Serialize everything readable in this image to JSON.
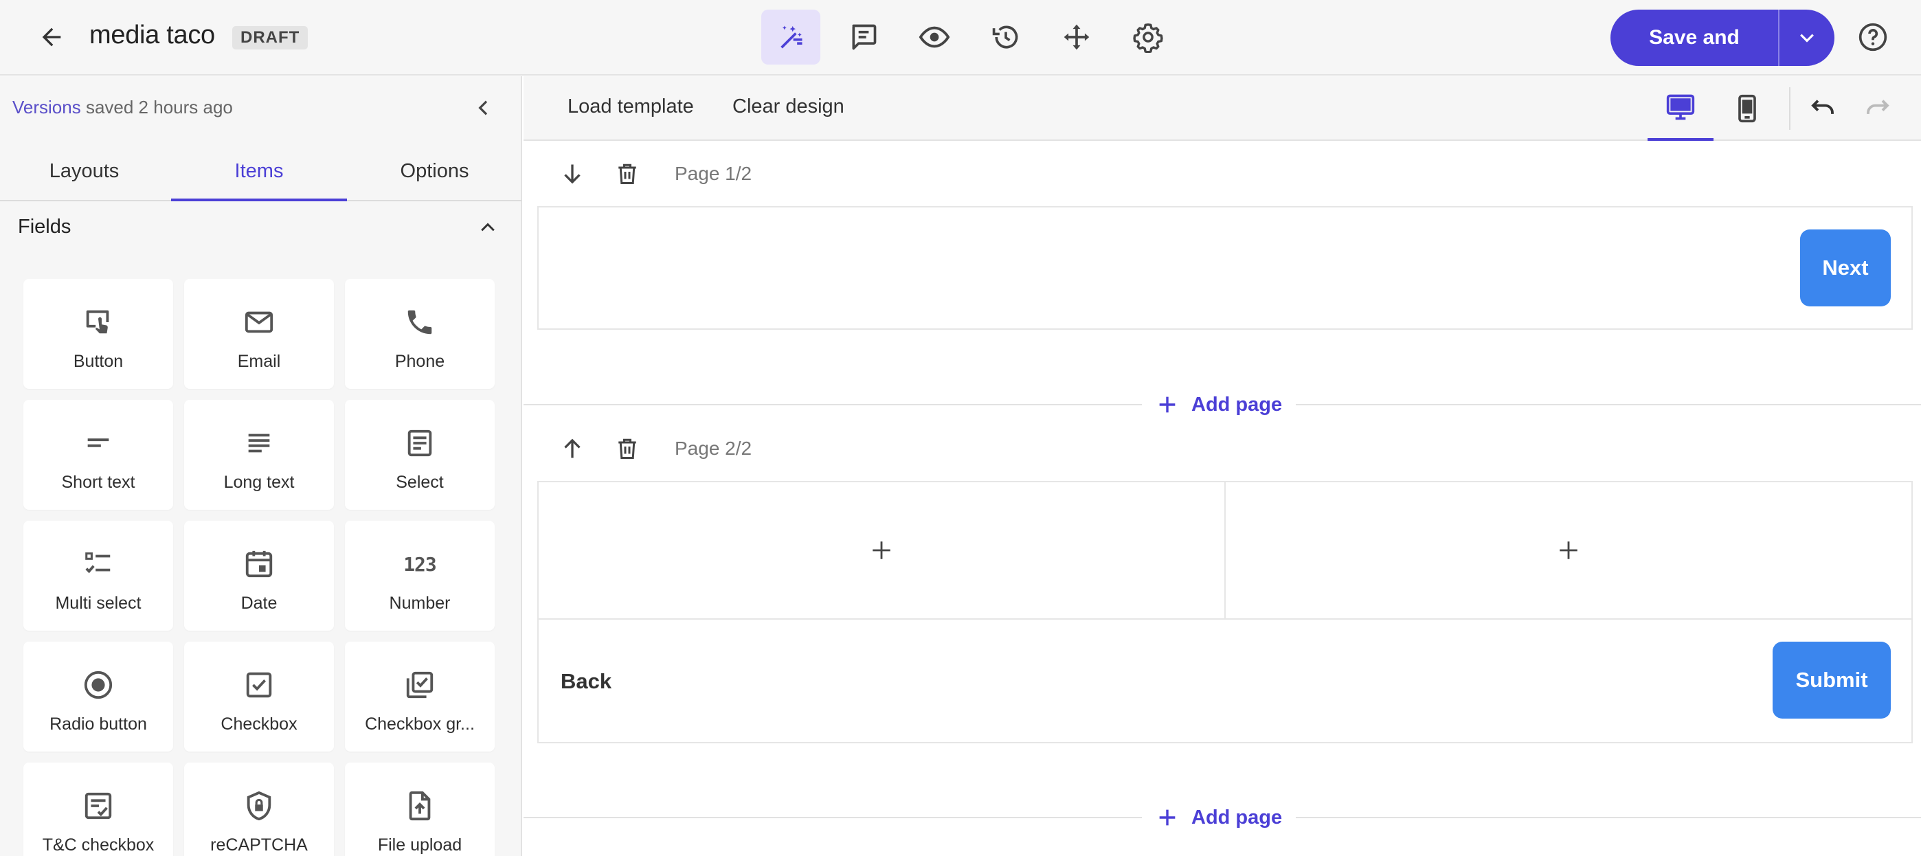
{
  "header": {
    "title": "media taco",
    "badge": "DRAFT",
    "save_label": "Save and exit"
  },
  "sidebar": {
    "versions_link": "Versions",
    "versions_text": " saved 2 hours ago",
    "tabs": [
      {
        "label": "Layouts"
      },
      {
        "label": "Items"
      },
      {
        "label": "Options"
      }
    ],
    "section_title": "Fields",
    "fields": [
      {
        "label": "Button",
        "icon": "touch-icon"
      },
      {
        "label": "Email",
        "icon": "envelope-icon"
      },
      {
        "label": "Phone",
        "icon": "phone-icon"
      },
      {
        "label": "Short text",
        "icon": "short-text-icon"
      },
      {
        "label": "Long text",
        "icon": "long-text-icon"
      },
      {
        "label": "Select",
        "icon": "select-icon"
      },
      {
        "label": "Multi select",
        "icon": "checklist-icon"
      },
      {
        "label": "Date",
        "icon": "calendar-icon"
      },
      {
        "label": "Number",
        "icon": "number-icon"
      },
      {
        "label": "Radio button",
        "icon": "radio-icon"
      },
      {
        "label": "Checkbox",
        "icon": "checkbox-icon"
      },
      {
        "label": "Checkbox gr...",
        "icon": "checkbox-group-icon"
      },
      {
        "label": "T&C checkbox",
        "icon": "terms-icon"
      },
      {
        "label": "reCAPTCHA",
        "icon": "shield-lock-icon"
      },
      {
        "label": "File upload",
        "icon": "file-upload-icon"
      }
    ],
    "number_glyph": "123"
  },
  "toolbar": {
    "load_template": "Load template",
    "clear_design": "Clear design"
  },
  "pages": [
    {
      "label": "Page 1/2",
      "next_label": "Next"
    },
    {
      "label": "Page 2/2",
      "back_label": "Back",
      "submit_label": "Submit"
    }
  ],
  "add_page_label": "Add page",
  "colors": {
    "accent": "#4b3fd6",
    "button_blue": "#3b86ee",
    "panel_bg": "#f6f6f6"
  }
}
